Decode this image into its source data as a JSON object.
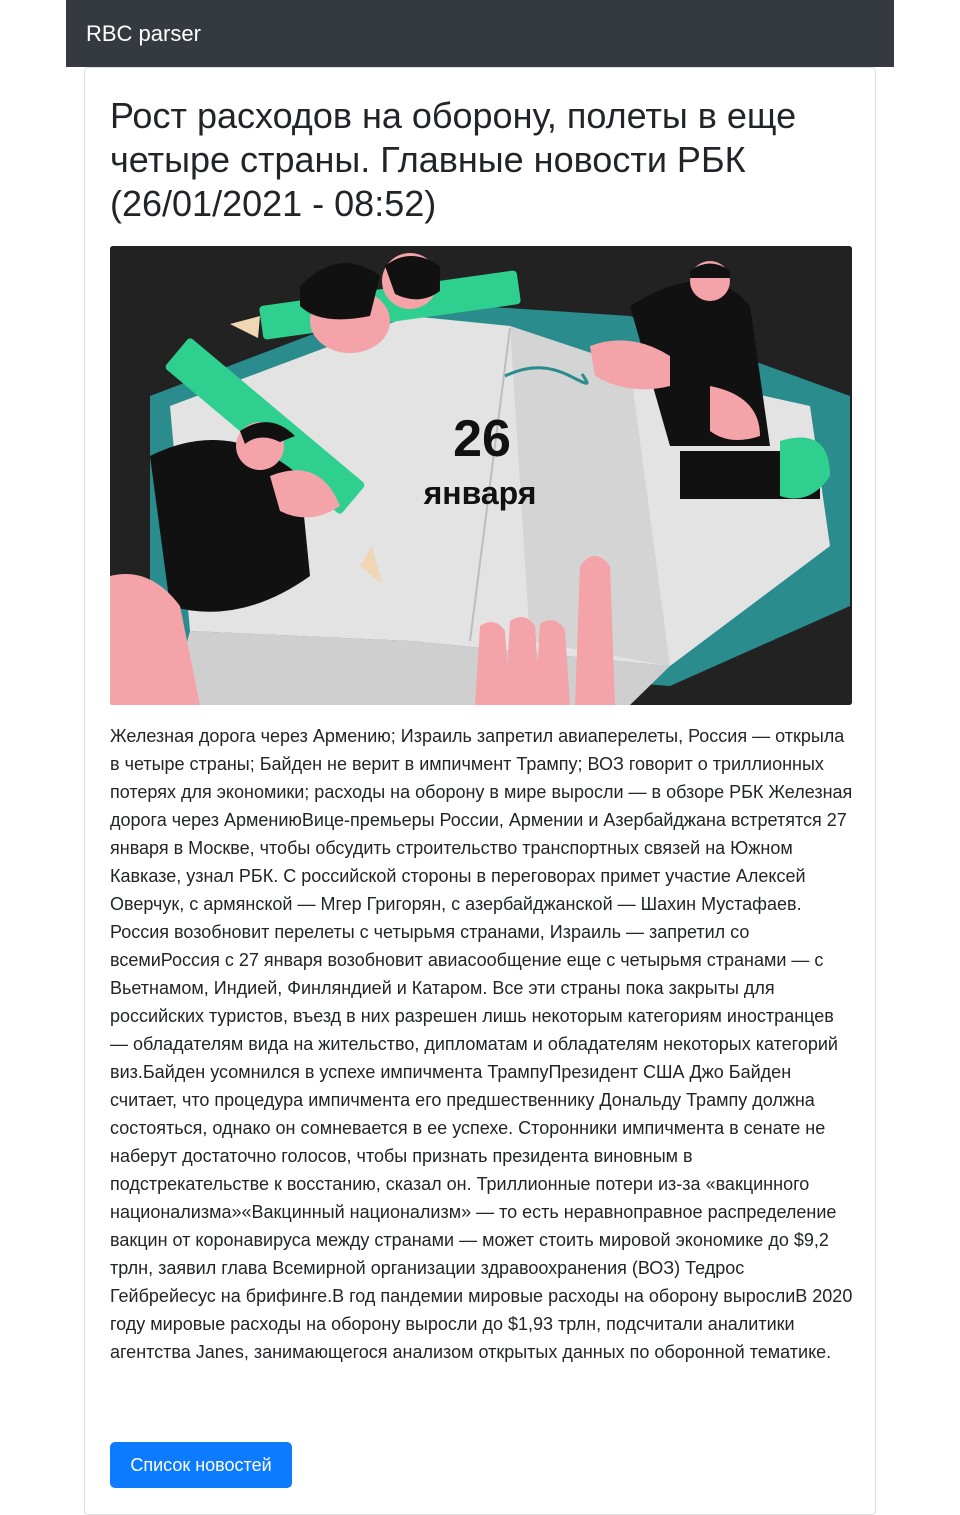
{
  "navbar": {
    "brand": "RBC parser"
  },
  "article": {
    "title": "Рост расходов на оборону, полеты в еще четыре страны. Главные новости РБК (26/01/2021 - 08:52)",
    "image": {
      "day": "26",
      "month": "января"
    },
    "body": "Железная дорога через Армению; Израиль запретил авиаперелеты, Россия — открыла в четыре страны; Байден не верит в импичмент Трампу; ВОЗ говорит о триллионных потерях для экономики; расходы на оборону в мире выросли — в обзоре РБК Железная дорога через АрмениюВице-премьеры России, Армении и Азербайджана встретятся 27 января в Москве, чтобы обсудить строительство транспортных связей на Южном Кавказе, узнал РБК. С российской стороны в переговорах примет участие Алексей Оверчук, с армянской — Мгер Григорян, с азербайджанской — Шахин Мустафаев. Россия возобновит перелеты с четырьмя странами, Израиль — запретил со всемиРоссия с 27 января возобновит авиасообщение еще с четырьмя странами — с Вьетнамом, Индией, Финляндией и Катаром. Все эти страны пока закрыты для российских туристов, въезд в них разрешен лишь некоторым категориям иностранцев — обладателям вида на жительство, дипломатам и обладателям некоторых категорий виз.Байден усомнился в успехе импичмента ТрампуПрезидент США Джо Байден считает, что процедура импичмента его предшественнику Дональду Трампу должна состояться, однако он сомневается в ее успехе. Сторонники импичмента в сенате не наберут достаточно голосов, чтобы признать президента виновным в подстрекательстве к восстанию, сказал он. Триллионные потери из-за «вакцинного национализма»«Вакцинный национализм» — то есть неравноправное распределение вакцин от коронавируса между странами — может стоить мировой экономике до $9,2 трлн, заявил глава Всемирной организации здравоохранения (ВОЗ) Тедрос Гейбрейесус на брифинге.В год пандемии мировые расходы на оборону вырослиВ 2020 году мировые расходы на оборону выросли до $1,93 трлн, подсчитали аналитики агентства Janes, занимающегося анализом открытых данных по оборонной тематике."
  },
  "actions": {
    "news_list_label": "Список новостей"
  },
  "colors": {
    "navbar_bg": "#343a40",
    "primary": "#0d7bfd",
    "hero_bg": "#1f1f1f",
    "accent_green": "#2fd08f",
    "skin_pink": "#f4a3a8"
  }
}
